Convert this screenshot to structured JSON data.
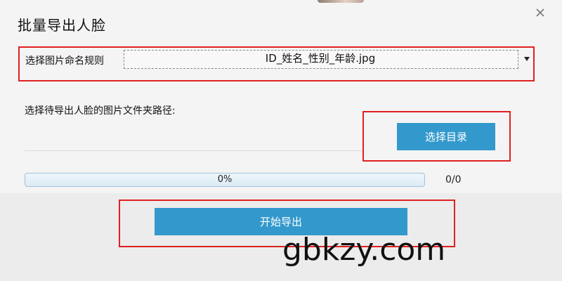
{
  "dialog": {
    "title": "批量导出人脸",
    "close_icon": "close-icon"
  },
  "naming_rule": {
    "label": "选择图片命名规则",
    "selected": "ID_姓名_性别_年龄.jpg",
    "arrow_icon": "dropdown-arrow-icon"
  },
  "folder": {
    "label": "选择待导出人脸的图片文件夹路径:",
    "browse_label": "选择目录"
  },
  "progress": {
    "percent_text": "0%",
    "fraction": 0,
    "count_text": "0/0"
  },
  "export": {
    "label": "开始导出"
  },
  "watermark": "gbkzy.com",
  "colors": {
    "accent": "#3399cc",
    "highlight": "#e02020",
    "dialog_bg": "#f4f4f4"
  }
}
